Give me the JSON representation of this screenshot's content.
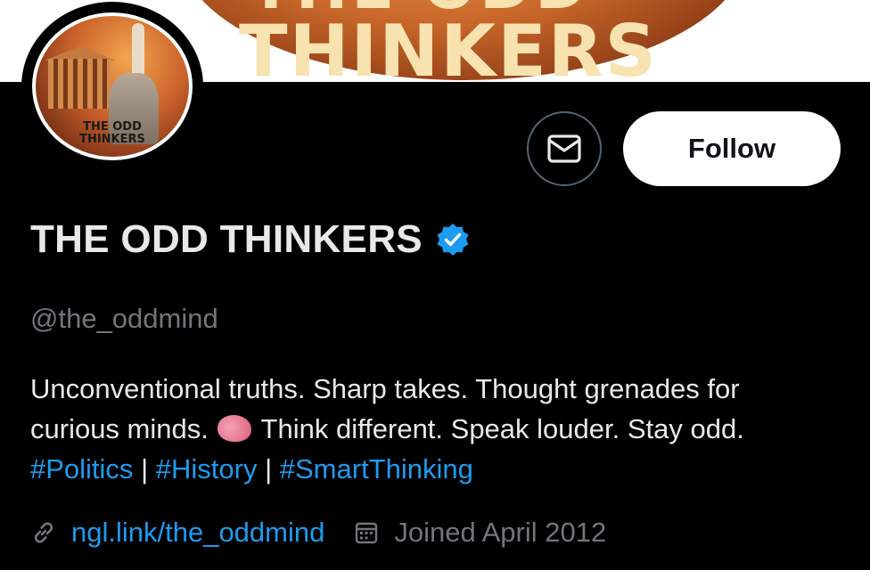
{
  "banner": {
    "text_top": "THE ODD",
    "text_main": "THINKERS"
  },
  "avatar": {
    "caption_line1": "THE ODD",
    "caption_line2": "THINKERS"
  },
  "actions": {
    "message_icon": "mail-icon",
    "follow_label": "Follow"
  },
  "profile": {
    "display_name": "THE ODD THINKERS",
    "verified_icon": "verified-badge-icon",
    "handle": "@the_oddmind",
    "bio_line1": "Unconventional truths. Sharp takes. Thought grenades for",
    "bio_line2_pre": "curious minds.",
    "bio_emoji": "brain-emoji-icon",
    "bio_line2_post": "Think different. Speak louder. Stay odd.",
    "hashtags": [
      "#Politics",
      "#History",
      "#SmartThinking"
    ],
    "separator": "|",
    "link_icon": "link-icon",
    "link_text": "ngl.link/the_oddmind",
    "calendar_icon": "calendar-icon",
    "joined_text": "Joined April 2012"
  },
  "colors": {
    "background": "#000000",
    "text": "#e7e9ea",
    "muted": "#71767b",
    "accent": "#1d9bf0",
    "follow_bg": "#ffffff"
  }
}
